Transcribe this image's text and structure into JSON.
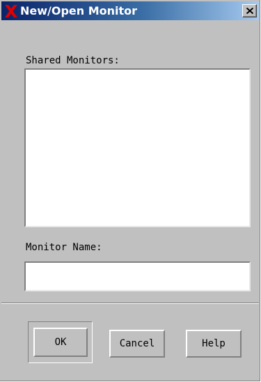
{
  "window": {
    "title": "New/Open Monitor",
    "title_icon": "x-logo-icon",
    "close_icon": "close-icon"
  },
  "shared_monitors": {
    "label": "Shared Monitors:",
    "items": []
  },
  "monitor_name": {
    "label": "Monitor Name:",
    "value": "",
    "placeholder": ""
  },
  "buttons": {
    "ok": "OK",
    "cancel": "Cancel",
    "help": "Help"
  },
  "colors": {
    "title_gradient_start": "#0a246a",
    "title_gradient_end": "#a6caf0",
    "dialog_background": "#c0c0c0",
    "x_logo": "#e00000"
  }
}
